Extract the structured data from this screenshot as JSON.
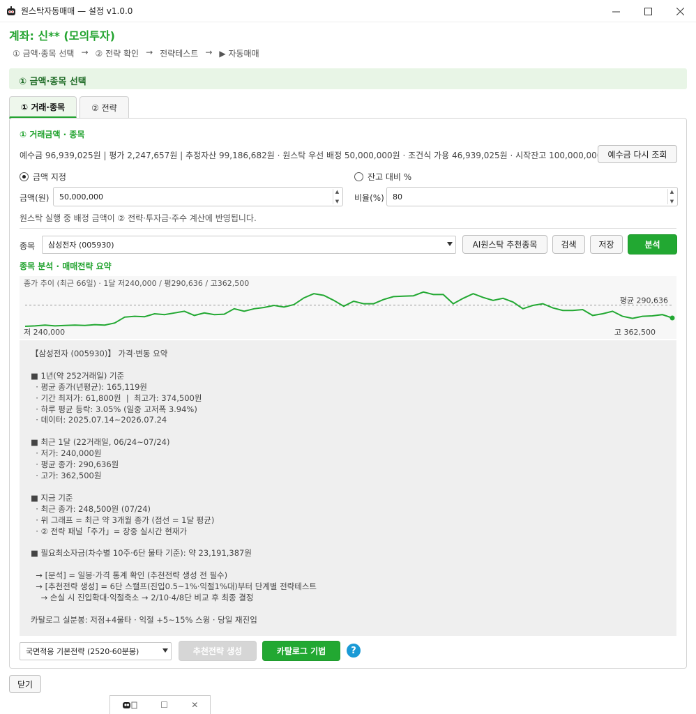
{
  "window": {
    "title": "원스탁자동매매 — 설정 v1.0.0"
  },
  "account": {
    "label": "계좌: 신** (모의투자)"
  },
  "steps": [
    "① 금액·종목 선택",
    "→",
    "② 전략 확인",
    "→",
    "전략테스트",
    "→",
    "▶ 자동매매"
  ],
  "section": {
    "title": "① 금액·종목 선택"
  },
  "tabs": [
    {
      "label": "① 거래·종목",
      "active": true
    },
    {
      "label": "② 전략",
      "active": false
    }
  ],
  "amount_section": {
    "title": "① 거래금액 · 종목",
    "info": "예수금 96,939,025원 | 평가 2,247,657원 | 추정자산 99,186,682원 · 원스탁 우선 배정 50,000,000원 · 조건식 가용 46,939,025원 · 시작잔고 100,000,000원",
    "refresh_button": "예수금 다시 조회",
    "radio_amount": "금액 지정",
    "radio_ratio": "잔고 대비 %",
    "amount_label": "금액(원)",
    "amount_value": "50,000,000",
    "ratio_label": "비율(%)",
    "ratio_value": "80",
    "note": "원스탁 실행 중 배정 금액이 ② 전략·투자금·주수 계산에 반영됩니다."
  },
  "stock_row": {
    "label": "종목",
    "selected": "삼성전자 (005930)",
    "ai_button": "AI원스탁 추천종목",
    "search_button": "검색",
    "save_button": "저장",
    "analyze_button": "분석"
  },
  "analysis": {
    "title": "종목 분석 · 매매전략 요약",
    "chart_caption": "종가 추이 (최근 66일) · 1달 저240,000 / 평290,636 / 고362,500",
    "avg_label": "평균 290,636",
    "low_label": "저 240,000",
    "high_label": "고 362,500"
  },
  "chart_data": {
    "type": "line",
    "title": "",
    "avg": 290636,
    "low": 240000,
    "high": 362500,
    "values": [
      240000,
      241000,
      243000,
      241000,
      242000,
      243000,
      242000,
      244000,
      243000,
      248000,
      262000,
      264000,
      263000,
      270000,
      268000,
      272000,
      276000,
      266000,
      272000,
      268000,
      269000,
      282000,
      276000,
      282000,
      285000,
      290000,
      286000,
      292000,
      308000,
      318000,
      314000,
      302000,
      288000,
      300000,
      294000,
      294000,
      304000,
      311000,
      312000,
      313000,
      322000,
      316000,
      316000,
      294000,
      307000,
      318000,
      309000,
      302000,
      307000,
      298000,
      282000,
      290000,
      294000,
      284000,
      278000,
      278000,
      280000,
      266000,
      270000,
      276000,
      264000,
      259000,
      264000,
      265000,
      268000,
      260000
    ]
  },
  "summary_text": "【삼성전자 (005930)】 가격·변동 요약\n\n■ 1년(약 252거래일) 기준\n  · 평균 종가(년평균): 165,119원\n  · 기간 최저가: 61,800원  |  최고가: 374,500원\n  · 하루 평균 등락: 3.05% (일중 고저폭 3.94%)\n  · 데이터: 2025.07.14~2026.07.24\n\n■ 최근 1달 (22거래일, 06/24~07/24)\n  · 저가: 240,000원\n  · 평균 종가: 290,636원\n  · 고가: 362,500원\n\n■ 지금 기준\n  · 최근 종가: 248,500원 (07/24)\n  · 위 그래프 = 최근 약 3개월 종가 (점선 = 1달 평균)\n  · ② 전략 패널「주가」= 장중 실시간 현재가\n\n■ 필요최소자금(차수별 10주·6단 물타 기준): 약 23,191,387원\n\n  → [분석] = 일봉·가격 통계 확인 (추천전략 생성 전 필수)\n  → [추천전략 생성] = 6단 스캘프(진입0.5~1%·익절1%대)부터 단계별 전략테스트\n    → 손실 시 진입확대·익절축소 → 2/10·4/8단 비교 후 최종 결정\n\n카탈로그 실분봉: 저점+4물타 · 익절 +5~15% 스윙 · 당일 재진입",
  "bottom": {
    "strategy_select": "국면적응 기본전략 (2520·60분봉)",
    "generate_button": "추천전략 생성",
    "catalog_button": "카탈로그 기법",
    "help": "?"
  },
  "close_button": "닫기",
  "colors": {
    "accent": "#22a832",
    "header_bg": "#e8f5e6",
    "help": "#1a9ad6"
  }
}
